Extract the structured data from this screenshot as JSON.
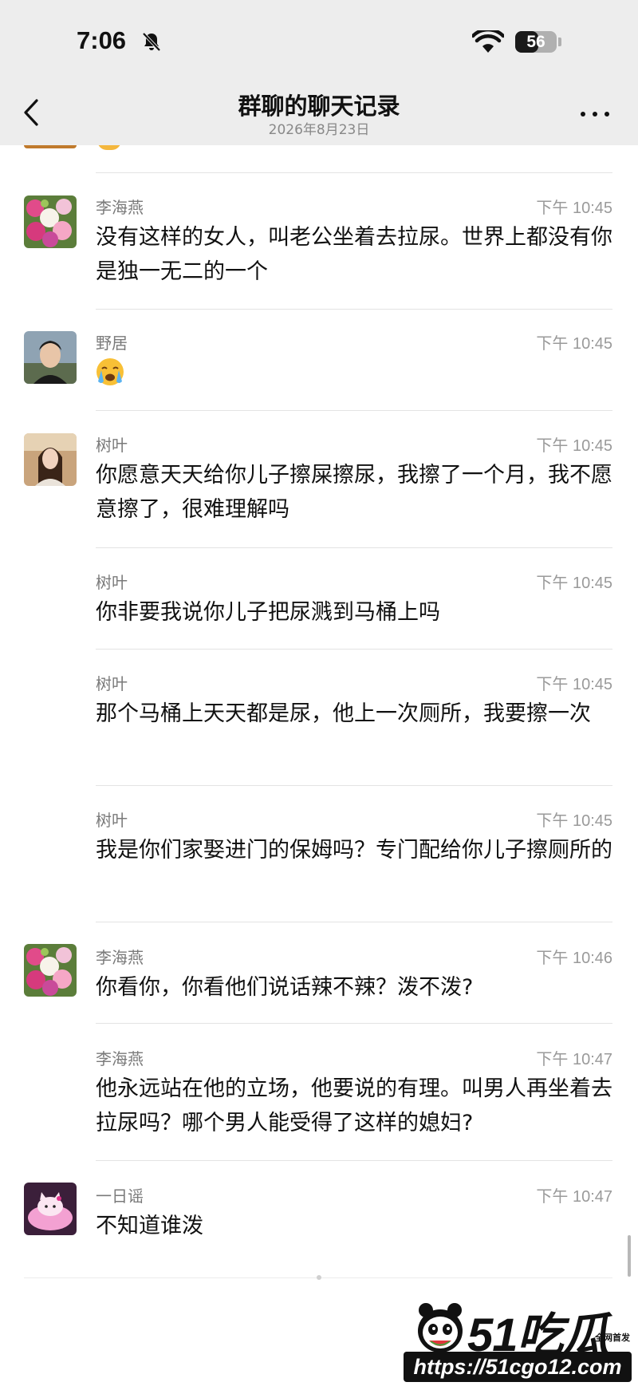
{
  "status_bar": {
    "time": "7:06",
    "battery": "56",
    "battery_level": 0.56
  },
  "header": {
    "title": "群聊的聊天记录",
    "subtitle": "2026年8月23日"
  },
  "messages": [
    {
      "name": "李海燕",
      "time": "下午 10:45",
      "text": "没有这样的女人，叫老公坐着去拉尿。世界上都没有你是独一无二的一个",
      "avatar": "flower-bouquet"
    },
    {
      "name": "野居",
      "time": "下午 10:45",
      "text": "",
      "emoji": "loudly-crying-face",
      "avatar": "young-man"
    },
    {
      "name": "树叶",
      "time": "下午 10:45",
      "text": "你愿意天天给你儿子擦屎擦尿，我擦了一个月，我不愿意擦了，很难理解吗",
      "avatar": "young-woman"
    },
    {
      "name": "树叶",
      "time": "下午 10:45",
      "text": "你非要我说你儿子把尿溅到马桶上吗"
    },
    {
      "name": "树叶",
      "time": "下午 10:45",
      "text": "那个马桶上天天都是尿，他上一次厕所，我要擦一次"
    },
    {
      "name": "树叶",
      "time": "下午 10:45",
      "text": "我是你们家娶进门的保姆吗？专门配给你儿子擦厕所的"
    },
    {
      "name": "李海燕",
      "time": "下午 10:46",
      "text": "你看你，你看他们说话辣不辣？泼不泼?",
      "avatar": "flower-bouquet"
    },
    {
      "name": "李海燕",
      "time": "下午 10:47",
      "text": "他永远站在他的立场，他要说的有理。叫男人再坐着去拉尿吗？哪个男人能受得了这样的媳妇?"
    },
    {
      "name": "一日谣",
      "time": "下午 10:47",
      "text": "不知道谁泼",
      "avatar": "pink-cat-toy"
    }
  ],
  "watermark": {
    "logo": "51吃瓜",
    "tag": "全网首发",
    "url": "https://51cgo12.com"
  },
  "colors": {
    "topbar": "#ededed",
    "name": "#7a7a7a",
    "time": "#9a9a9a",
    "divider": "#e3e3e3"
  }
}
